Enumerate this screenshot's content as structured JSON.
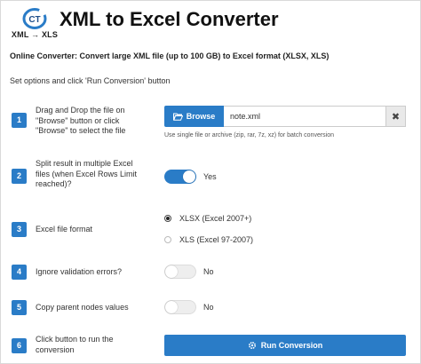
{
  "header": {
    "logo_text": "CT",
    "logo_sub": "XML → XLS",
    "title": "XML to Excel Converter"
  },
  "subtitle": "Online Converter: Convert large XML file (up to 100 GB) to Excel format (XLSX, XLS)",
  "instruction": "Set options and click 'Run Conversion' button",
  "steps": [
    {
      "number": "1",
      "label_lines": [
        "Drag and Drop the file on",
        "\"Browse\" button or click",
        "\"Browse\" to select the file"
      ],
      "browse_label": "Browse",
      "file_value": "note.xml",
      "clear_label": "✖",
      "hint": "Use single file or archive (zip, rar, 7z, xz) for batch conversion"
    },
    {
      "number": "2",
      "label_lines": [
        "Split result in multiple Excel",
        "files (when Excel Rows Limit",
        "reached)?"
      ],
      "toggle_state": "on",
      "toggle_label": "Yes"
    },
    {
      "number": "3",
      "label_lines": [
        "Excel file format"
      ],
      "options": [
        {
          "label": "XLSX (Excel 2007+)",
          "checked": true
        },
        {
          "label": "XLS (Excel 97-2007)",
          "checked": false
        }
      ]
    },
    {
      "number": "4",
      "label_lines": [
        "Ignore validation errors?"
      ],
      "toggle_state": "off",
      "toggle_label": "No"
    },
    {
      "number": "5",
      "label_lines": [
        "Copy parent nodes values"
      ],
      "toggle_state": "off",
      "toggle_label": "No"
    },
    {
      "number": "6",
      "label_lines": [
        "Click button to run the",
        "conversion"
      ],
      "button_label": "Run Conversion"
    }
  ],
  "colors": {
    "accent": "#2a7cc7",
    "badge_text": "#ffffff"
  },
  "icons": {
    "browse": "folder-open-icon",
    "clear": "close-icon",
    "run": "gear-icon"
  }
}
